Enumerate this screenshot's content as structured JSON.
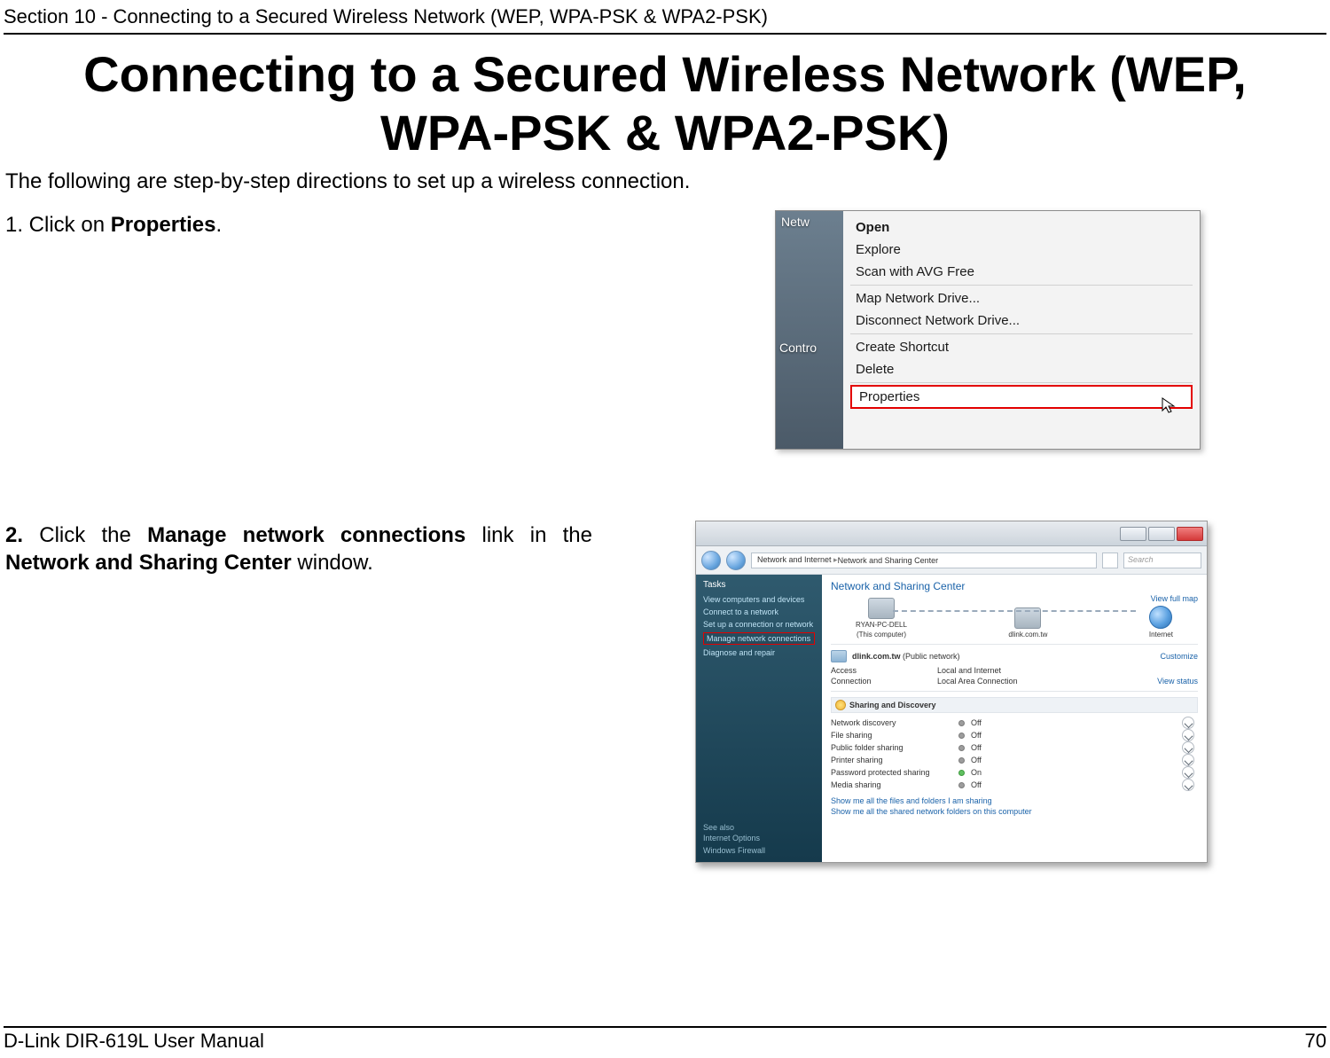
{
  "header": {
    "section_title": "Section 10 - Connecting to a Secured Wireless Network (WEP, WPA-PSK & WPA2-PSK)"
  },
  "heading": "Connecting to a Secured Wireless Network (WEP, WPA-PSK & WPA2-PSK)",
  "intro": "The following are step-by-step directions to set up a wireless connection.",
  "step1": {
    "prefix": "1. Click on ",
    "bold": "Properties",
    "suffix": "."
  },
  "step2": {
    "prefix": "2. ",
    "t1": "Click the ",
    "b1": "Manage network connections",
    "t2": " link in the ",
    "b2": "Network and Sharing Center",
    "t3": " window."
  },
  "ctx_menu": {
    "desk_text_1": "Netw",
    "desk_text_2": "Contro",
    "items_top": [
      "Open",
      "Explore",
      "Scan with AVG Free"
    ],
    "items_mid": [
      "Map Network Drive...",
      "Disconnect Network Drive..."
    ],
    "items_bot": [
      "Create Shortcut",
      "Delete"
    ],
    "highlight": "Properties"
  },
  "nsc": {
    "crumbs": [
      "Network and Internet",
      "Network and Sharing Center"
    ],
    "search_placeholder": "Search",
    "tasks_title": "Tasks",
    "tasks": [
      "View computers and devices",
      "Connect to a network",
      "Set up a connection or network"
    ],
    "task_highlight": "Manage network connections",
    "task_after": "Diagnose and repair",
    "see_also_label": "See also",
    "see_also_1": "Internet Options",
    "see_also_2": "Windows Firewall",
    "title": "Network and Sharing Center",
    "view_full_map": "View full map",
    "node1": "RYAN-PC-DELL",
    "node1_sub": "(This computer)",
    "node2": "dlink.com.tw",
    "node3": "Internet",
    "net_line_bold": "dlink.com.tw",
    "net_line_rest": " (Public network)",
    "customize": "Customize",
    "access_label": "Access",
    "access_val": "Local and Internet",
    "conn_label": "Connection",
    "conn_val": "Local Area Connection",
    "view_status": "View status",
    "sharing_title": "Sharing and Discovery",
    "rows": [
      {
        "label": "Network discovery",
        "state": "Off",
        "on": false
      },
      {
        "label": "File sharing",
        "state": "Off",
        "on": false
      },
      {
        "label": "Public folder sharing",
        "state": "Off",
        "on": false
      },
      {
        "label": "Printer sharing",
        "state": "Off",
        "on": false
      },
      {
        "label": "Password protected sharing",
        "state": "On",
        "on": true
      },
      {
        "label": "Media sharing",
        "state": "Off",
        "on": false
      }
    ],
    "link1": "Show me all the files and folders I am sharing",
    "link2": "Show me all the shared network folders on this computer"
  },
  "footer": {
    "left": "D-Link DIR-619L User Manual",
    "right": "70"
  }
}
